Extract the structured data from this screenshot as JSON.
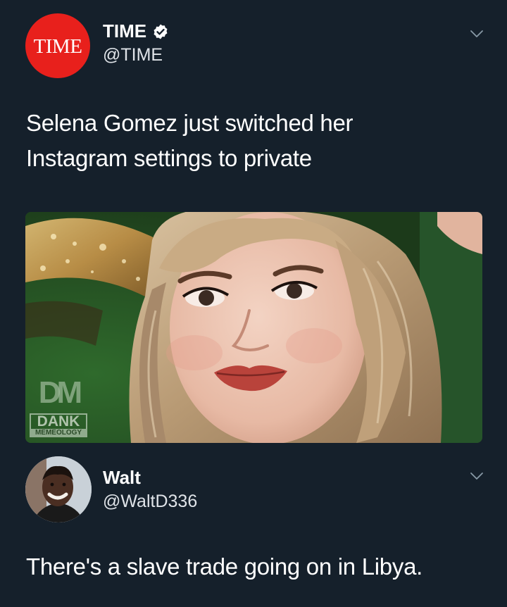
{
  "main_tweet": {
    "avatar_text": "TIME",
    "display_name": "TIME",
    "handle": "@TIME",
    "text": "Selena Gomez just switched her\nInstagram settings to private",
    "media": {
      "watermark_logo": "DM",
      "watermark_line1": "DANK",
      "watermark_line2": "MEMEOLOGY"
    }
  },
  "reply_tweet": {
    "display_name": "Walt",
    "handle": "@WaltD336",
    "text": "There's a slave trade going on in Libya."
  },
  "colors": {
    "background": "#15202b",
    "time_red": "#e8201c",
    "verified_badge": "#ffffff"
  },
  "icons": {
    "verified": "verified-badge-icon",
    "menu": "chevron-down-icon"
  }
}
